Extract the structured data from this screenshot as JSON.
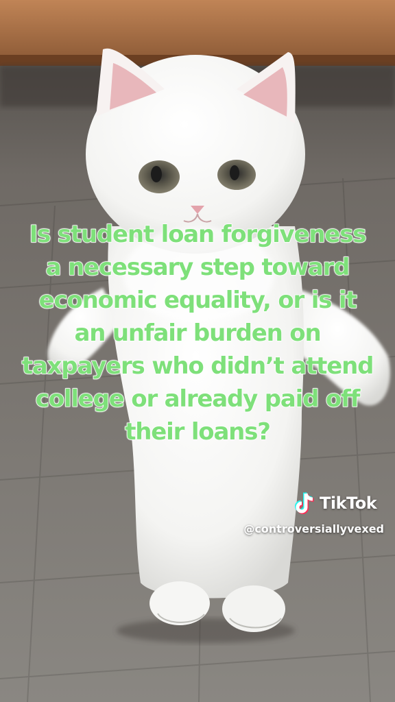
{
  "caption": "Is student loan forgiveness a necessary step toward economic equality, or is it an unfair burden on taxpayers who didn’t attend college or already paid off their loans?",
  "watermark": {
    "brand": "TikTok",
    "handle": "@controversiallyvexed",
    "icon": "tiktok-note-icon"
  },
  "colors": {
    "caption_fill": "#7ee07a",
    "caption_outline": "#ffffff"
  }
}
